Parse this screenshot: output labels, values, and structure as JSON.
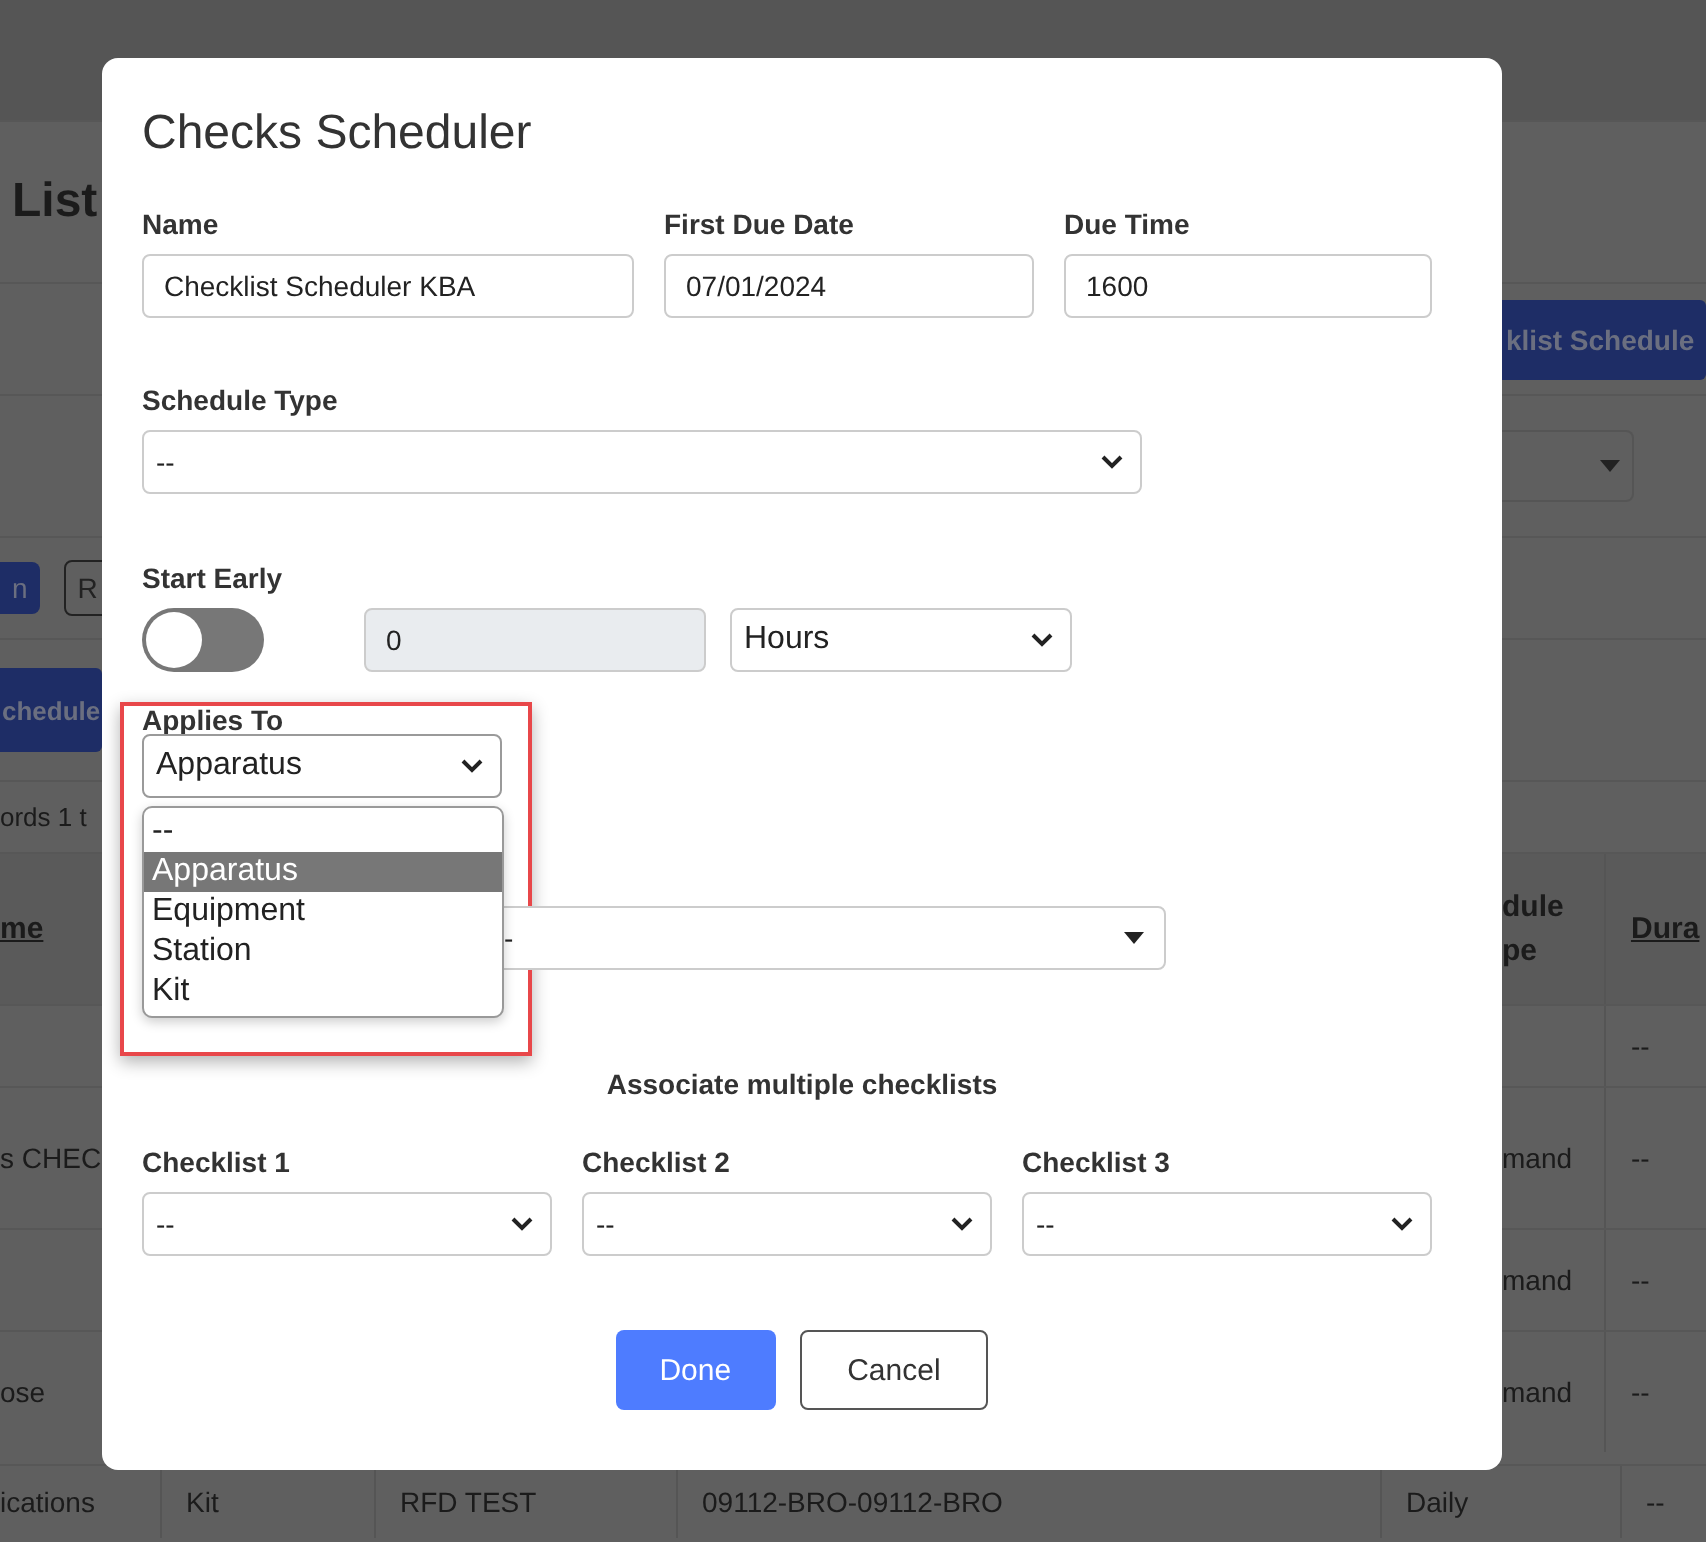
{
  "background": {
    "heading": "List",
    "top_button": "klist Schedule",
    "filter_buttons": [
      {
        "label": "n",
        "kind": "primary"
      },
      {
        "label": "R",
        "kind": "outline"
      }
    ],
    "schedule_button": "chedule",
    "records_info": "ords 1 t",
    "table": {
      "name_header": "me",
      "type_header": [
        "dule",
        "pe"
      ],
      "duration_header": "Dura",
      "rows": [
        {
          "name": "",
          "schedule_type": "",
          "duration": "--"
        },
        {
          "name": "s CHEC",
          "schedule_type": "mand",
          "duration": "--"
        },
        {
          "name": "",
          "schedule_type": "mand",
          "duration": "--"
        },
        {
          "name": "ose",
          "schedule_type": "mand",
          "duration": "--"
        }
      ],
      "last_row": [
        "ications",
        "Kit",
        "RFD TEST",
        "09112-BRO-09112-BRO",
        "Daily",
        "--"
      ]
    }
  },
  "dialog": {
    "title": "Checks Scheduler",
    "name": {
      "label": "Name",
      "value": "Checklist Scheduler KBA"
    },
    "first_due_date": {
      "label": "First Due Date",
      "value": "07/01/2024"
    },
    "due_time": {
      "label": "Due Time",
      "value": "1600"
    },
    "schedule_type": {
      "label": "Schedule Type",
      "value": "--"
    },
    "start_early": {
      "label": "Start Early",
      "on": false,
      "amount": {
        "value": "0",
        "disabled": true
      },
      "unit": "Hours"
    },
    "applies_to": {
      "label": "Applies To",
      "value": "Apparatus",
      "expanded": true,
      "highlighted": true,
      "options": [
        {
          "label": "--",
          "selected": false
        },
        {
          "label": "Apparatus",
          "selected": true
        },
        {
          "label": "Equipment",
          "selected": false
        },
        {
          "label": "Station",
          "selected": false
        },
        {
          "label": "Kit",
          "selected": false
        }
      ]
    },
    "covered_select": {
      "value": "-"
    },
    "checklists": {
      "heading": "Associate multiple checklists",
      "items": [
        {
          "label": "Checklist 1",
          "value": "--"
        },
        {
          "label": "Checklist 2",
          "value": "--"
        },
        {
          "label": "Checklist 3",
          "value": "--"
        }
      ]
    },
    "buttons": [
      {
        "label": "Done",
        "kind": "primary"
      },
      {
        "label": "Cancel",
        "kind": "secondary"
      }
    ]
  }
}
